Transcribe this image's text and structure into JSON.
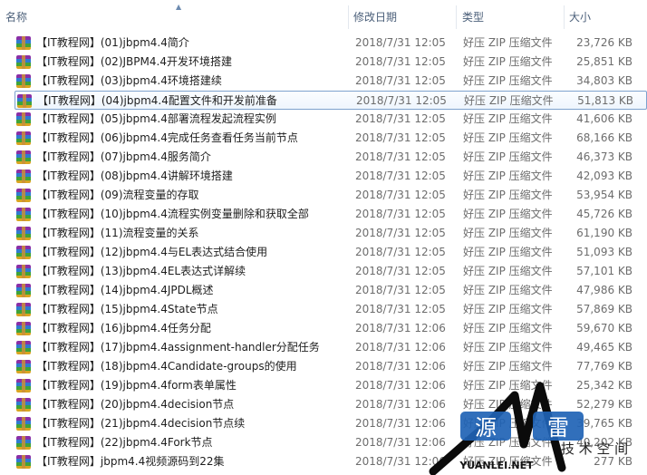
{
  "columns": {
    "name": "名称",
    "date": "修改日期",
    "type": "类型",
    "size": "大小"
  },
  "files": [
    {
      "name": "【IT教程网】(01)jbpm4.4简介",
      "date": "2018/7/31 12:05",
      "type": "好压 ZIP 压缩文件",
      "size": "23,726 KB"
    },
    {
      "name": "【IT教程网】(02)JBPM4.4开发环境搭建",
      "date": "2018/7/31 12:05",
      "type": "好压 ZIP 压缩文件",
      "size": "25,851 KB"
    },
    {
      "name": "【IT教程网】(03)jbpm4.4环境搭建续",
      "date": "2018/7/31 12:05",
      "type": "好压 ZIP 压缩文件",
      "size": "34,803 KB"
    },
    {
      "name": "【IT教程网】(04)jbpm4.4配置文件和开发前准备",
      "date": "2018/7/31 12:05",
      "type": "好压 ZIP 压缩文件",
      "size": "51,813 KB",
      "selected": true
    },
    {
      "name": "【IT教程网】(05)jbpm4.4部署流程发起流程实例",
      "date": "2018/7/31 12:05",
      "type": "好压 ZIP 压缩文件",
      "size": "41,606 KB"
    },
    {
      "name": "【IT教程网】(06)jbpm4.4完成任务查看任务当前节点",
      "date": "2018/7/31 12:05",
      "type": "好压 ZIP 压缩文件",
      "size": "68,166 KB"
    },
    {
      "name": "【IT教程网】(07)jbpm4.4服务简介",
      "date": "2018/7/31 12:05",
      "type": "好压 ZIP 压缩文件",
      "size": "46,373 KB"
    },
    {
      "name": "【IT教程网】(08)jbpm4.4讲解环境搭建",
      "date": "2018/7/31 12:05",
      "type": "好压 ZIP 压缩文件",
      "size": "42,093 KB"
    },
    {
      "name": "【IT教程网】(09)流程变量的存取",
      "date": "2018/7/31 12:05",
      "type": "好压 ZIP 压缩文件",
      "size": "53,954 KB"
    },
    {
      "name": "【IT教程网】(10)jbpm4.4流程实例变量删除和获取全部",
      "date": "2018/7/31 12:05",
      "type": "好压 ZIP 压缩文件",
      "size": "45,726 KB"
    },
    {
      "name": "【IT教程网】(11)流程变量的关系",
      "date": "2018/7/31 12:05",
      "type": "好压 ZIP 压缩文件",
      "size": "61,190 KB"
    },
    {
      "name": "【IT教程网】(12)jbpm4.4与EL表达式结合使用",
      "date": "2018/7/31 12:05",
      "type": "好压 ZIP 压缩文件",
      "size": "51,093 KB"
    },
    {
      "name": "【IT教程网】(13)jbpm4.4EL表达式详解续",
      "date": "2018/7/31 12:05",
      "type": "好压 ZIP 压缩文件",
      "size": "57,101 KB"
    },
    {
      "name": "【IT教程网】(14)jbpm4.4JPDL概述",
      "date": "2018/7/31 12:05",
      "type": "好压 ZIP 压缩文件",
      "size": "47,986 KB"
    },
    {
      "name": "【IT教程网】(15)jbpm4.4State节点",
      "date": "2018/7/31 12:05",
      "type": "好压 ZIP 压缩文件",
      "size": "57,869 KB"
    },
    {
      "name": "【IT教程网】(16)jbpm4.4任务分配",
      "date": "2018/7/31 12:06",
      "type": "好压 ZIP 压缩文件",
      "size": "59,670 KB"
    },
    {
      "name": "【IT教程网】(17)jbpm4.4assignment-handler分配任务",
      "date": "2018/7/31 12:06",
      "type": "好压 ZIP 压缩文件",
      "size": "49,465 KB"
    },
    {
      "name": "【IT教程网】(18)jbpm4.4Candidate-groups的使用",
      "date": "2018/7/31 12:06",
      "type": "好压 ZIP 压缩文件",
      "size": "77,769 KB"
    },
    {
      "name": "【IT教程网】(19)jbpm4.4form表单属性",
      "date": "2018/7/31 12:06",
      "type": "好压 ZIP 压缩文件",
      "size": "25,342 KB"
    },
    {
      "name": "【IT教程网】(20)jbpm4.4decision节点",
      "date": "2018/7/31 12:06",
      "type": "好压 ZIP 压缩文件",
      "size": "52,279 KB"
    },
    {
      "name": "【IT教程网】(21)jbpm4.4decision节点续",
      "date": "2018/7/31 12:06",
      "type": "好压 ZIP 压缩文件",
      "size": "39,765 KB"
    },
    {
      "name": "【IT教程网】(22)jbpm4.4Fork节点",
      "date": "2018/7/31 12:06",
      "type": "好压 ZIP 压缩文件",
      "size": "40,202 KB"
    },
    {
      "name": "【IT教程网】jbpm4.4视频源码到22集",
      "date": "2018/7/31 12:06",
      "type": "好压 ZIP 压缩文件",
      "size": "277 KB"
    }
  ],
  "watermark": {
    "char1": "源",
    "char2": "雷",
    "subtitle": "技 术 空 间",
    "url": "YUANLEI.NET"
  },
  "colors": {
    "selection_border": "#7da2ce",
    "header_text": "#4c607a",
    "watermark_blue": "#1f63b5"
  },
  "icons": {
    "file": "winrar-archive-icon",
    "sort": "sort-arrow-icon"
  }
}
